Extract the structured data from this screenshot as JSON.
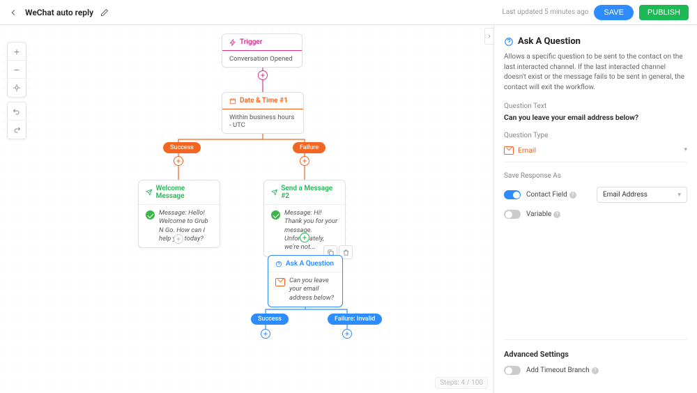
{
  "header": {
    "title": "WeChat auto reply",
    "last_updated": "Last updated 5 minutes ago",
    "save": "SAVE",
    "publish": "PUBLISH"
  },
  "canvas": {
    "trigger": {
      "title": "Trigger",
      "body": "Conversation Opened"
    },
    "date": {
      "title": "Date & Time #1",
      "body": "Within business hours - UTC"
    },
    "welcome": {
      "title": "Welcome Message",
      "prefix": "Message:",
      "body": " Hello! Welcome to Grub N Go. How can I help you today?"
    },
    "msg2": {
      "title": "Send a Message #2",
      "prefix": "Message:",
      "body": " Hi! Thank you for your message. Unfortunately, we're not..."
    },
    "ask": {
      "title": "Ask A Question",
      "body": "Can you leave your email address below?"
    },
    "pills": {
      "success1": "Success",
      "failure1": "Failure",
      "success2": "Success",
      "failure2": "Failure: Invalid"
    },
    "steps": "Steps: 4 / 100"
  },
  "sidebar": {
    "title": "Ask A Question",
    "desc": "Allows a specific question to be sent to the contact on the last interacted channel. If the last interacted channel doesn't exist or the message fails to be sent in general, the contact will exit the workflow.",
    "qtext_label": "Question Text",
    "qtext_value": "Can you leave your email address below?",
    "qtype_label": "Question Type",
    "qtype_value": "Email",
    "save_as_label": "Save Response As",
    "contact_field": "Contact Field",
    "variable": "Variable",
    "cf_value": "Email Address",
    "advanced": "Advanced Settings",
    "timeout": "Add Timeout Branch"
  }
}
